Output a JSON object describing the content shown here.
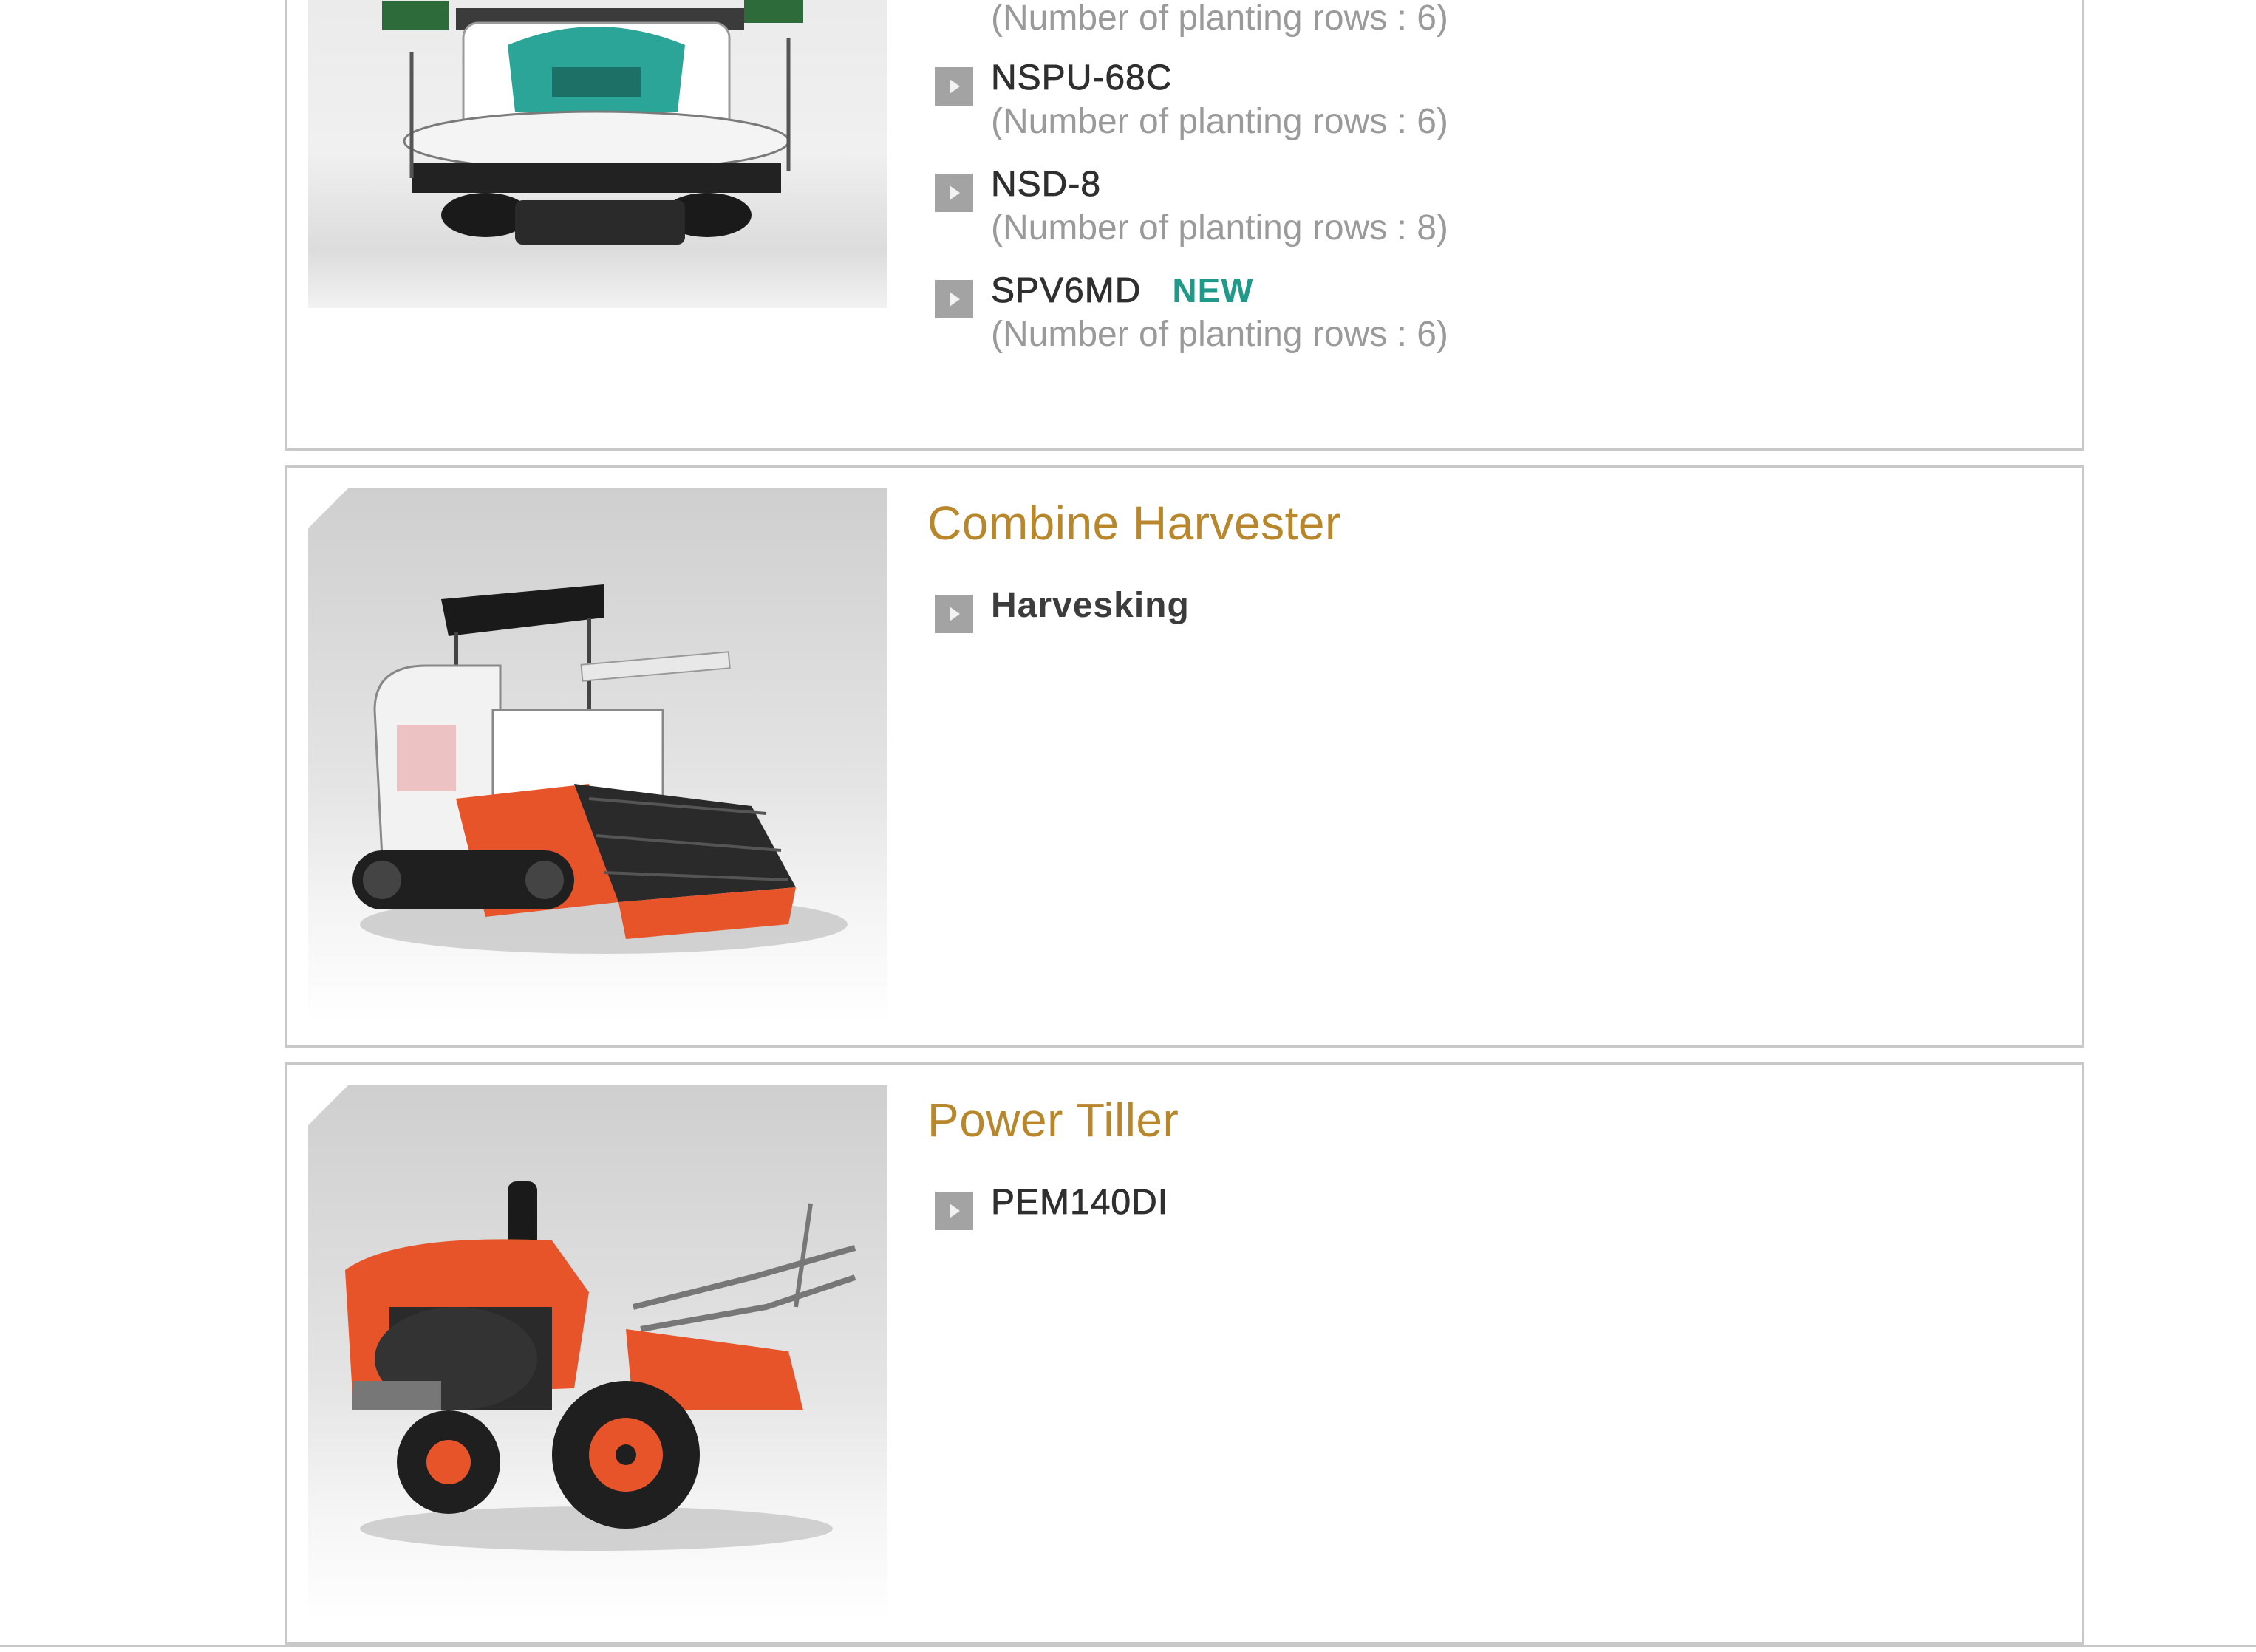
{
  "rice_transplanter": {
    "models": [
      {
        "name": "",
        "spec": "(Number of planting rows : 6)"
      },
      {
        "name": "NSPU-68C",
        "spec": "(Number of planting rows : 6)"
      },
      {
        "name": "NSD-8",
        "spec": "(Number of planting rows : 8)"
      },
      {
        "name": "SPV6MD",
        "badge": "NEW",
        "spec": "(Number of planting rows : 6)"
      }
    ]
  },
  "combine_harvester": {
    "title": "Combine Harvester",
    "models": [
      {
        "name": "Harvesking"
      }
    ]
  },
  "power_tiller": {
    "title": "Power Tiller",
    "models": [
      {
        "name": "PEM140DI"
      }
    ]
  },
  "colors": {
    "category_title": "#b8862b",
    "new_badge": "#1f9a8a",
    "card_border": "#c8c8c8",
    "bullet": "#a3a3a3",
    "spec_text": "#9a9a9a",
    "machine_orange": "#e8542a"
  }
}
